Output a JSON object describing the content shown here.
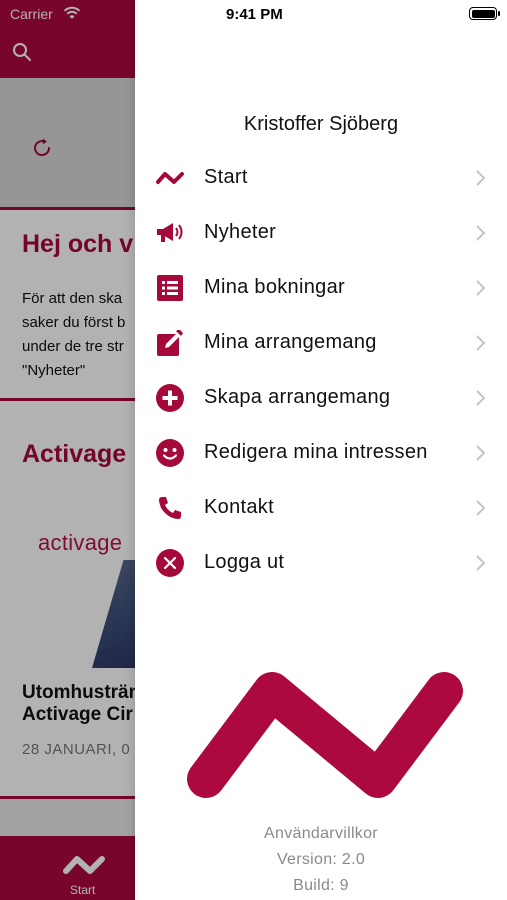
{
  "status_bar": {
    "carrier": "Carrier",
    "time": "9:41 PM"
  },
  "background": {
    "hej_title": "Hej och v",
    "hej_body": "För att den ska\nsaker du först b\nunder de tre str\n\"Nyheter\"",
    "activage_title": "Activage",
    "activage_logo": "activage",
    "event_title": "Utomhusträn\nActivage Cir",
    "event_date": "28 JANUARI, 0",
    "tab_label": "Start"
  },
  "drawer": {
    "user_name": "Kristoffer Sjöberg",
    "menu": [
      {
        "label": "Start",
        "icon": "start-zigzag-icon"
      },
      {
        "label": "Nyheter",
        "icon": "megaphone-icon"
      },
      {
        "label": "Mina bokningar",
        "icon": "list-icon"
      },
      {
        "label": "Mina arrangemang",
        "icon": "edit-icon"
      },
      {
        "label": "Skapa arrangemang",
        "icon": "plus-circle-icon"
      },
      {
        "label": "Redigera mina intressen",
        "icon": "smiley-icon"
      },
      {
        "label": "Kontakt",
        "icon": "phone-icon"
      },
      {
        "label": "Logga ut",
        "icon": "close-circle-icon"
      }
    ],
    "footer": {
      "terms": "Användarvillkor",
      "version": "Version: 2.0",
      "build": "Build: 9"
    }
  },
  "colors": {
    "brand": "#ac0a3e",
    "icon": "#a5093a",
    "chevron": "#c4c4c4"
  }
}
